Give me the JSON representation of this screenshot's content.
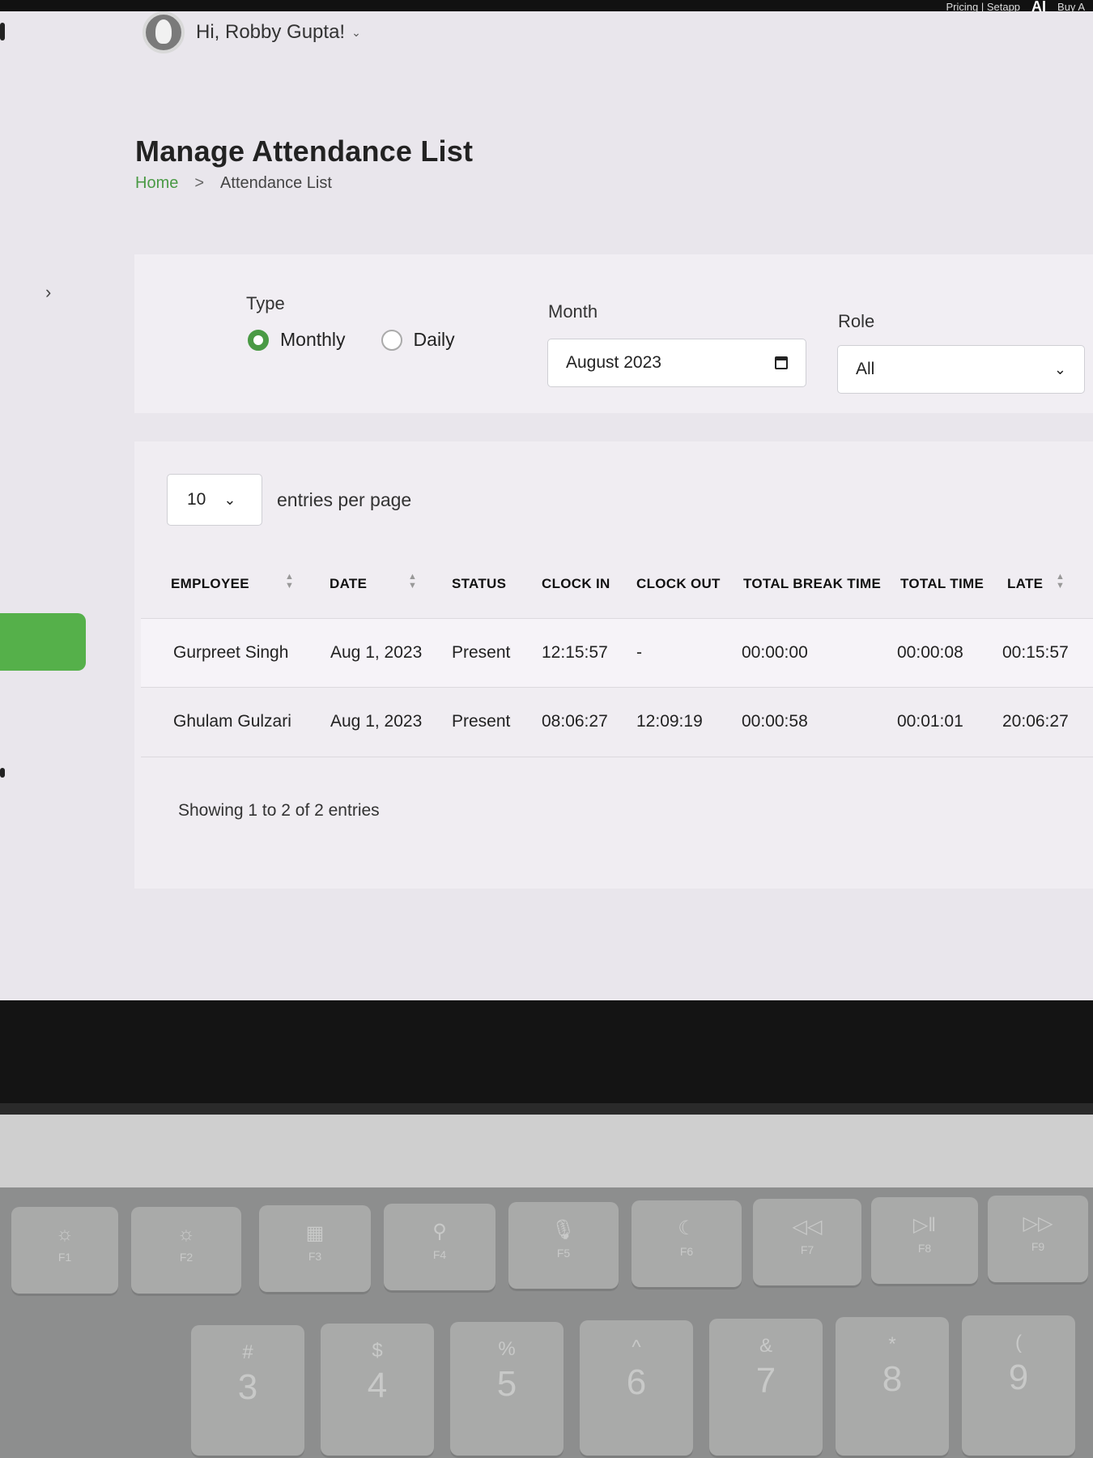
{
  "top_links": [
    "Pricing | Setapp",
    "AI",
    "Buy A"
  ],
  "user": {
    "greeting": "Hi, Robby Gupta!",
    "chevron": "⌄"
  },
  "page": {
    "title": "Manage Attendance List",
    "breadcrumb": {
      "home": "Home",
      "sep": ">",
      "current": "Attendance List"
    }
  },
  "filters": {
    "type_label": "Type",
    "type_options": [
      {
        "label": "Monthly",
        "selected": true
      },
      {
        "label": "Daily",
        "selected": false
      }
    ],
    "month_label": "Month",
    "month_value": "August 2023",
    "role_label": "Role",
    "role_value": "All"
  },
  "table": {
    "per_page_value": "10",
    "per_page_text": "entries per page",
    "columns": [
      "EMPLOYEE",
      "DATE",
      "STATUS",
      "CLOCK IN",
      "CLOCK OUT",
      "TOTAL BREAK TIME",
      "TOTAL TIME",
      "LATE"
    ],
    "rows": [
      [
        "Gurpreet Singh",
        "Aug 1, 2023",
        "Present",
        "12:15:57",
        "-",
        "00:00:00",
        "00:00:08",
        "00:15:57"
      ],
      [
        "Ghulam Gulzari",
        "Aug 1, 2023",
        "Present",
        "08:06:27",
        "12:09:19",
        "00:00:58",
        "00:01:01",
        "20:06:27"
      ]
    ],
    "footer": "Showing 1 to 2 of 2 entries"
  },
  "keyboard": {
    "fn_keys": [
      {
        "icon": "☼",
        "label": "F1"
      },
      {
        "icon": "☼",
        "label": "F2"
      },
      {
        "icon": "▦",
        "label": "F3"
      },
      {
        "icon": "⚲",
        "label": "F4"
      },
      {
        "icon": "🎙",
        "label": "F5"
      },
      {
        "icon": "☾",
        "label": "F6"
      },
      {
        "icon": "◁◁",
        "label": "F7"
      },
      {
        "icon": "▷‖",
        "label": "F8"
      },
      {
        "icon": "▷▷",
        "label": "F9"
      }
    ],
    "num_keys": [
      {
        "top": "#",
        "main": "3"
      },
      {
        "top": "$",
        "main": "4"
      },
      {
        "top": "%",
        "main": "5"
      },
      {
        "top": "^",
        "main": "6"
      },
      {
        "top": "&",
        "main": "7"
      },
      {
        "top": "*",
        "main": "8"
      },
      {
        "top": "(",
        "main": "9"
      }
    ]
  }
}
